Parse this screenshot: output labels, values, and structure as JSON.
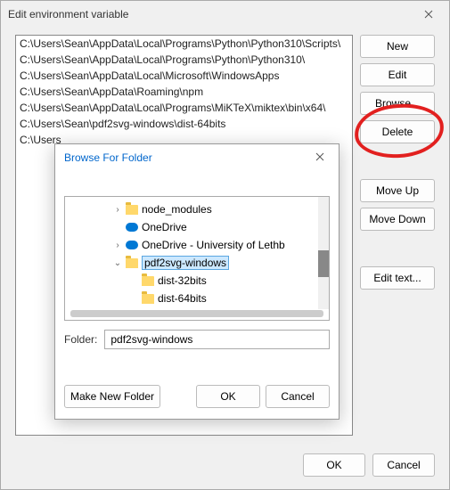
{
  "window": {
    "title": "Edit environment variable"
  },
  "paths": [
    "C:\\Users\\Sean\\AppData\\Local\\Programs\\Python\\Python310\\Scripts\\",
    "C:\\Users\\Sean\\AppData\\Local\\Programs\\Python\\Python310\\",
    "C:\\Users\\Sean\\AppData\\Local\\Microsoft\\WindowsApps",
    "C:\\Users\\Sean\\AppData\\Roaming\\npm",
    "C:\\Users\\Sean\\AppData\\Local\\Programs\\MiKTeX\\miktex\\bin\\x64\\",
    "C:\\Users\\Sean\\pdf2svg-windows\\dist-64bits",
    "C:\\Users"
  ],
  "buttons": {
    "new": "New",
    "edit": "Edit",
    "browse": "Browse...",
    "delete": "Delete",
    "move_up": "Move Up",
    "move_down": "Move Down",
    "edit_text": "Edit text...",
    "ok": "OK",
    "cancel": "Cancel"
  },
  "browse": {
    "title": "Browse For Folder",
    "folder_label": "Folder:",
    "folder_value": "pdf2svg-windows",
    "make_new": "Make New Folder",
    "ok": "OK",
    "cancel": "Cancel",
    "tree": {
      "items": [
        {
          "indent": 3,
          "expander": "›",
          "icon": "folder",
          "label": "node_modules",
          "selected": false
        },
        {
          "indent": 3,
          "expander": "",
          "icon": "onedrive",
          "label": "OneDrive",
          "selected": false
        },
        {
          "indent": 3,
          "expander": "›",
          "icon": "onedrive",
          "label": "OneDrive - University of Lethb",
          "selected": false
        },
        {
          "indent": 3,
          "expander": "⌄",
          "icon": "folder",
          "label": "pdf2svg-windows",
          "selected": true
        },
        {
          "indent": 4,
          "expander": "",
          "icon": "folder",
          "label": "dist-32bits",
          "selected": false
        },
        {
          "indent": 4,
          "expander": "",
          "icon": "folder",
          "label": "dist-64bits",
          "selected": false
        }
      ]
    }
  }
}
